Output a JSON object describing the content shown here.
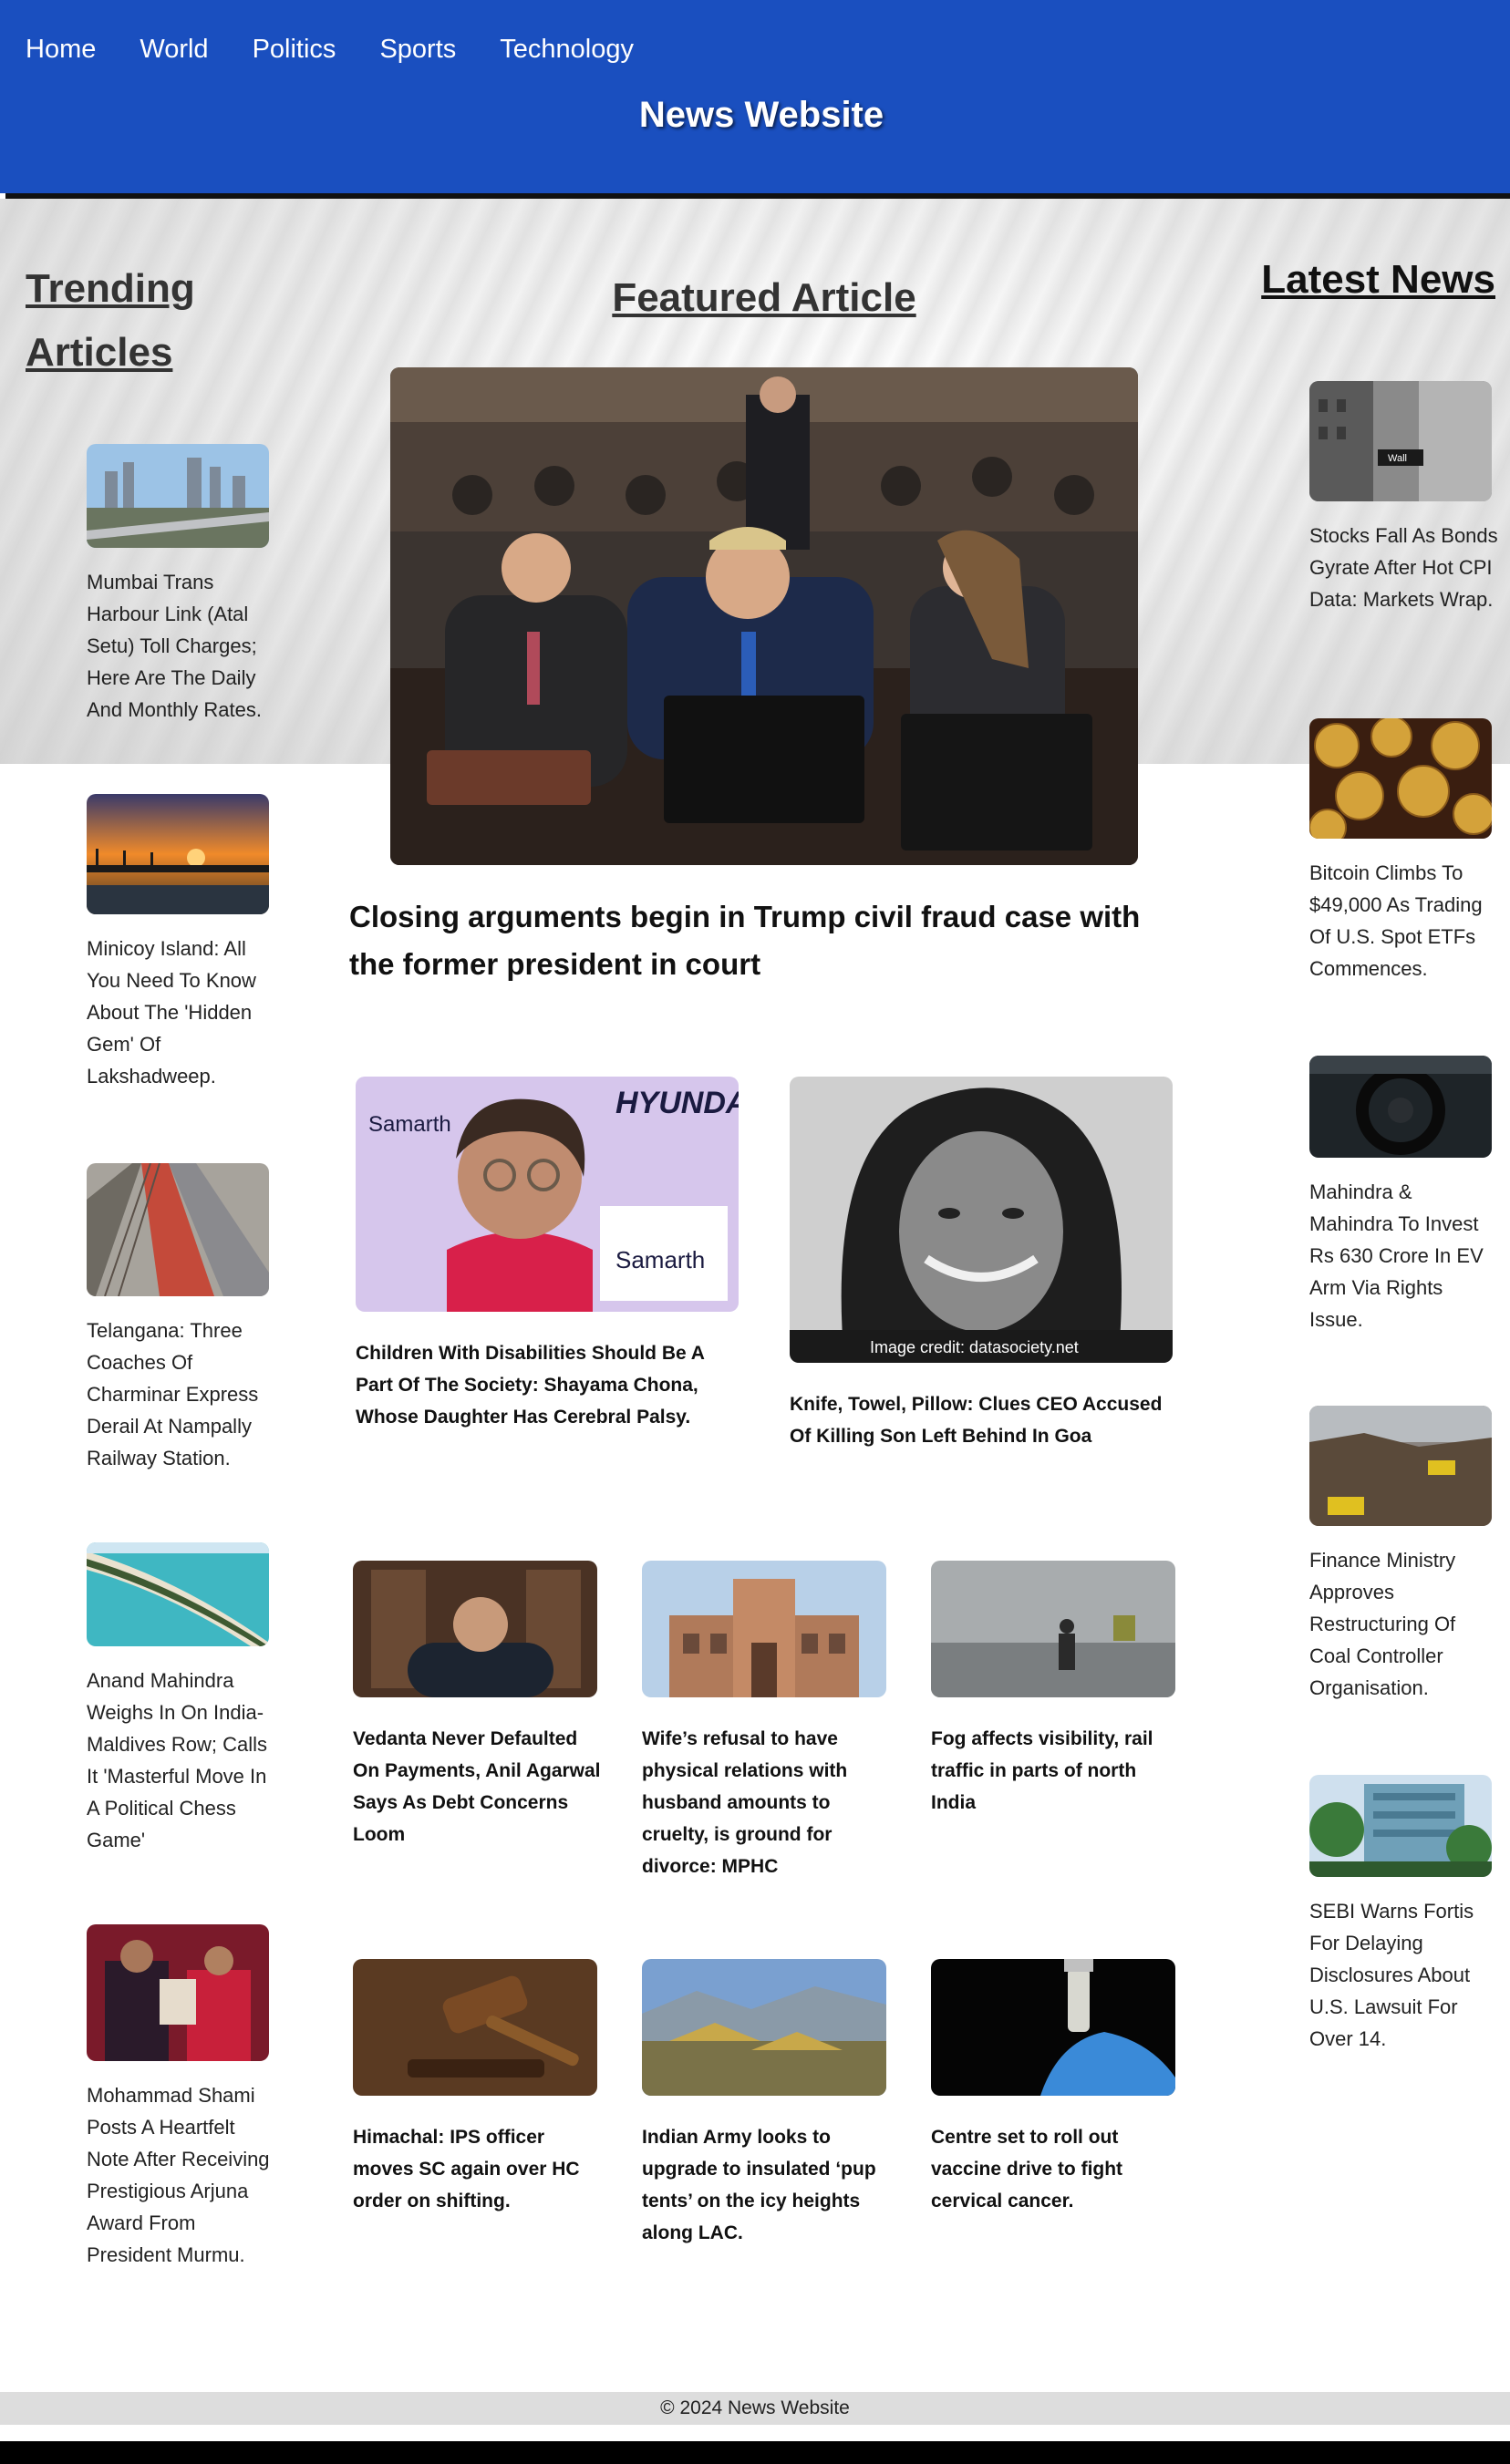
{
  "nav": {
    "items": [
      "Home",
      "World",
      "Politics",
      "Sports",
      "Technology"
    ]
  },
  "site_title": "News Website",
  "sections": {
    "trending": "Trending Articles",
    "featured": "Featured Article",
    "latest": "Latest News"
  },
  "featured": {
    "title": "Closing arguments begin in Trump civil fraud case with the former president in court"
  },
  "trending": [
    {
      "caption": "Mumbai Trans Harbour Link (Atal Setu) Toll Charges; Here Are The Daily And Monthly Rates."
    },
    {
      "caption": "Minicoy Island: All You Need To Know About The 'Hidden Gem' Of Lakshadweep."
    },
    {
      "caption": "Telangana: Three Coaches Of Charminar Express Derail At Nampally Railway Station."
    },
    {
      "caption": "Anand Mahindra Weighs In On India-Maldives Row; Calls It 'Masterful Move In A Political Chess Game'"
    },
    {
      "caption": "Mohammad Shami Posts A Heartfelt Note After Receiving Prestigious Arjuna Award From President Murmu."
    }
  ],
  "latest": [
    {
      "caption": "Stocks Fall As Bonds Gyrate After Hot CPI Data: Markets Wrap."
    },
    {
      "caption": "Bitcoin Climbs To $49,000 As Trading Of U.S. Spot ETFs Commences."
    },
    {
      "caption": "Mahindra & Mahindra To Invest Rs 630 Crore In EV Arm Via Rights Issue."
    },
    {
      "caption": "Finance Ministry Approves Restructuring Of Coal Controller Organisation."
    },
    {
      "caption": "SEBI Warns Fortis For Delaying Disclosures About U.S. Lawsuit For Over 14."
    }
  ],
  "cards_large": [
    {
      "caption": "Children With Disabilities Should Be A Part Of The Society: Shayama Chona, Whose Daughter Has Cerebral Palsy.",
      "image_text_1": "Samarth",
      "image_text_2": "HYUNDAI"
    },
    {
      "caption": "Knife, Towel, Pillow: Clues CEO Accused Of Killing Son Left Behind In Goa",
      "image_credit": "Image credit: datasociety.net"
    }
  ],
  "cards_row1": [
    {
      "caption": "Vedanta Never Defaulted On Payments, Anil Agarwal Says As Debt Concerns Loom"
    },
    {
      "caption": "Wife’s refusal to have physical relations with husband amounts to cruelty, is ground for divorce: MPHC"
    },
    {
      "caption": "Fog affects visibility, rail traffic in parts of north India"
    }
  ],
  "cards_row2": [
    {
      "caption": "Himachal: IPS officer moves SC again over HC order on shifting."
    },
    {
      "caption": "Indian Army looks to upgrade to insulated ‘pup tents’ on the icy heights along LAC."
    },
    {
      "caption": "Centre set to roll out vaccine drive to fight cervical cancer."
    }
  ],
  "footer": "© 2024 News Website",
  "colors": {
    "header": "#1a4fbf",
    "footer": "#dddddd"
  }
}
